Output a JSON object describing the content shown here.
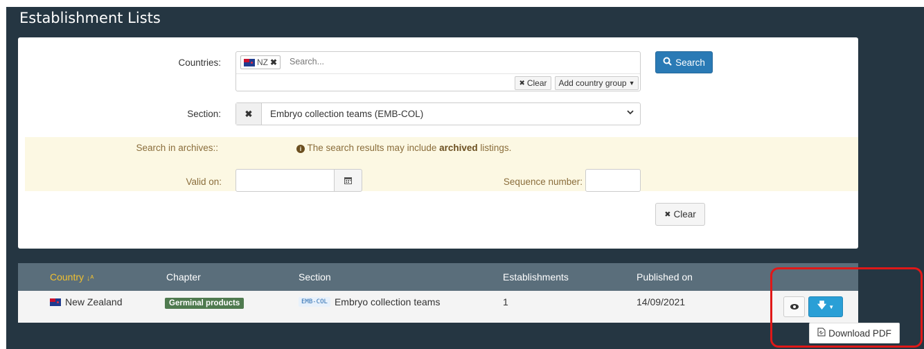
{
  "page": {
    "title": "Establishment Lists"
  },
  "filters": {
    "countries_label": "Countries:",
    "country_tag": "NZ",
    "search_placeholder": "Search...",
    "clear_label": "Clear",
    "add_group_label": "Add country group",
    "search_button": "Search",
    "section_label": "Section:",
    "section_value": "Embryo collection teams (EMB-COL)",
    "archives_label": "Search in archives::",
    "archives_note_prefix": "The search results may include",
    "archives_note_bold": "archived",
    "archives_note_suffix": "listings.",
    "valid_on_label": "Valid on:",
    "sequence_label": "Sequence number:",
    "clear_button": "Clear"
  },
  "table": {
    "headers": [
      "Country",
      "Chapter",
      "Section",
      "Establishments",
      "Published on"
    ],
    "rows": [
      {
        "country": "New Zealand",
        "chapter": "Germinal products",
        "section_code": "EMB-COL",
        "section": "Embryo collection teams",
        "establishments": "1",
        "published_on": "14/09/2021"
      }
    ]
  },
  "dropdown": {
    "download_pdf": "Download PDF"
  },
  "colors": {
    "header_bg": "#253642",
    "primary": "#2a7ab5",
    "highlight": "#e01818"
  }
}
